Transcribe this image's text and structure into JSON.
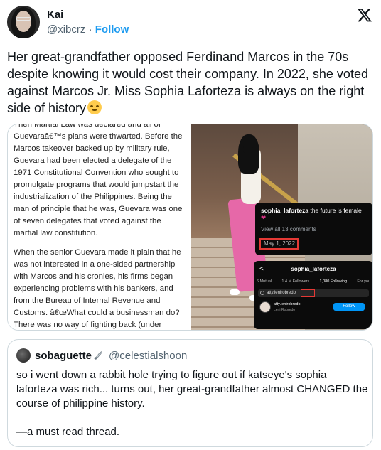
{
  "author": {
    "name": "Kai",
    "handle": "@xibcrz",
    "separator": "·",
    "follow_label": "Follow"
  },
  "brand": {
    "icon": "x-logo-icon"
  },
  "tweet": {
    "text": "Her great-grandfather opposed Ferdinand Marcos in the 70s despite knowing it would cost their company. In 2022, she voted against Marcos Jr. Miss Sophia Laforteza is always on the right side of history",
    "emoji": "relieved-face-emoji"
  },
  "media": {
    "article": {
      "paragraph1": "Then Martial Law was declared and all of Guevaraâ€™s plans were thwarted. Before the Marcos takeover backed up by military rule, Guevara had been elected a delegate of the 1971 Constitutional Convention who sought to promulgate programs that would jumpstart the industrialization of the Philippines. Being the man of principle that he was, Guevara was one of seven delegates that voted against the martial law constitution.",
      "paragraph2": "When the senior Guevara made it plain that he was not interested in a one-sided partnership with Marcos and his cronies, his firms began experiencing problems with his bankers, and from the Bureau of Internal Revenue and Customs. â€œWhat could a businessman do? There was no way of fighting back (under"
    },
    "instagram_post": {
      "username": "sophia_laforteza",
      "caption": "the future is female",
      "comments_link": "View all 13 comments",
      "date": "May 1, 2022"
    },
    "instagram_profile": {
      "back": "<",
      "title": "sophia_laforteza",
      "tabs": [
        "6 Mutual",
        "1.4 M Followers",
        "1,080 Following",
        "For you"
      ],
      "search_value": "atty.lenirobredo",
      "result_user": "atty.lenirobredo",
      "result_sub": "Leni Robredo",
      "follow_label": "Follow"
    }
  },
  "quote": {
    "name": "sobaguette",
    "icon": "knife-icon",
    "handle": "@celestialshoon",
    "text": "so i went down a rabbit hole trying to figure out if katseye's sophia laforteza was rich... turns out, her great-grandfather almost CHANGED the course of philippine history.",
    "text2": "—a must read thread."
  }
}
